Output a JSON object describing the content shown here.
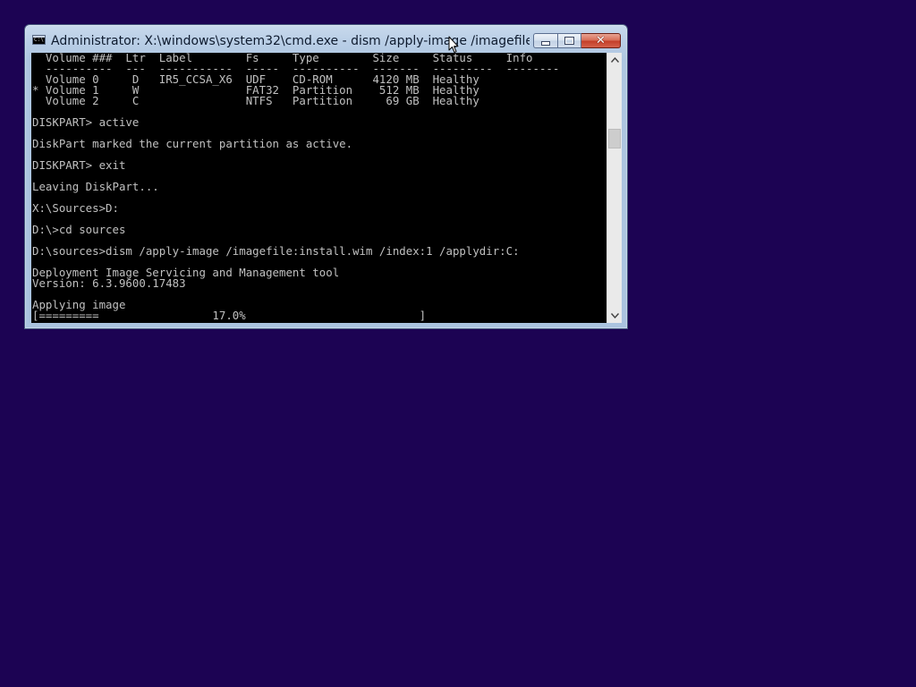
{
  "window": {
    "title": "Administrator: X:\\windows\\system32\\cmd.exe - dism  /apply-image /imagefile:...",
    "minimize_label": "",
    "maximize_label": "",
    "close_label": "✕"
  },
  "console": {
    "lines": [
      "  Volume ###  Ltr  Label        Fs     Type        Size     Status     Info",
      "  ----------  ---  -----------  -----  ----------  -------  ---------  --------",
      "  Volume 0     D   IR5_CCSA_X6  UDF    CD-ROM      4120 MB  Healthy",
      "* Volume 1     W                FAT32  Partition    512 MB  Healthy",
      "  Volume 2     C                NTFS   Partition     69 GB  Healthy",
      "",
      "DISKPART> active",
      "",
      "DiskPart marked the current partition as active.",
      "",
      "DISKPART> exit",
      "",
      "Leaving DiskPart...",
      "",
      "X:\\Sources>D:",
      "",
      "D:\\>cd sources",
      "",
      "D:\\sources>dism /apply-image /imagefile:install.wim /index:1 /applydir:C:",
      "",
      "Deployment Image Servicing and Management tool",
      "Version: 6.3.9600.17483",
      "",
      "Applying image",
      "[=========                 17.0%                          ]"
    ]
  },
  "scrollbar": {
    "up_icon": "scroll-up-arrow-icon",
    "down_icon": "scroll-down-arrow-icon"
  },
  "cursor": {
    "icon": "mouse-pointer-icon"
  },
  "colors": {
    "desktop_background": "#1c0353",
    "console_background": "#000000",
    "console_text": "#c0c0c0"
  }
}
